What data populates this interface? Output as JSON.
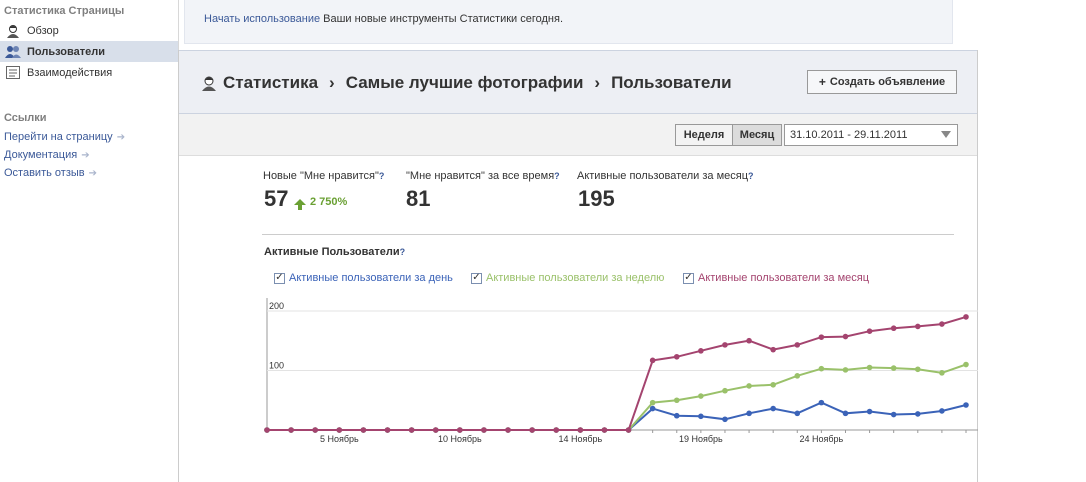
{
  "sidebar": {
    "section_stats": "Статистика Страницы",
    "items": [
      {
        "label": "Обзор",
        "icon": "user-avatar-icon",
        "active": false
      },
      {
        "label": "Пользователи",
        "icon": "users-icon",
        "active": true
      },
      {
        "label": "Взаимодействия",
        "icon": "interactions-icon",
        "active": false
      }
    ],
    "section_links": "Ссылки",
    "links": [
      "Перейти на страницу",
      "Документация",
      "Оставить отзыв"
    ]
  },
  "notice": {
    "link_text": "Начать использование",
    "text": " Ваши новые инструменты Статистики сегодня."
  },
  "breadcrumb": {
    "items": [
      "Статистика",
      "Самые лучшие фотографии",
      "Пользователи"
    ],
    "separator": "›"
  },
  "create_ad_label": "Создать объявление",
  "period": {
    "week_label": "Неделя",
    "month_label": "Месяц",
    "selected": "Месяц",
    "date_range": "31.10.2011 - 29.11.2011"
  },
  "metrics": [
    {
      "label": "Новые \"Мне нравится\"",
      "value": "57",
      "change": "2 750%"
    },
    {
      "label": "\"Мне нравится\" за все время",
      "value": "81"
    },
    {
      "label": "Активные пользователи за месяц",
      "value": "195"
    }
  ],
  "help_mark": "?",
  "chart_data": {
    "type": "line",
    "title": "Активные Пользователи",
    "ylim": [
      0,
      200
    ],
    "y_ticks": [
      100,
      200
    ],
    "x_tick_labels": [
      "5 Ноябрь",
      "10 Ноябрь",
      "14 Ноябрь",
      "19 Ноябрь",
      "24 Ноябрь"
    ],
    "x_tick_index": [
      3,
      8,
      13,
      18,
      23
    ],
    "legend": "top",
    "series": [
      {
        "name": "Активные пользователи за день",
        "color": "#3b63b8",
        "values": [
          0,
          0,
          0,
          0,
          0,
          0,
          0,
          0,
          0,
          0,
          0,
          0,
          0,
          0,
          0,
          0,
          36,
          24,
          23,
          18,
          28,
          36,
          28,
          46,
          28,
          31,
          26,
          27,
          32,
          42
        ]
      },
      {
        "name": "Активные пользователи за неделю",
        "color": "#9ac16a",
        "values": [
          0,
          0,
          0,
          0,
          0,
          0,
          0,
          0,
          0,
          0,
          0,
          0,
          0,
          0,
          0,
          0,
          46,
          50,
          57,
          66,
          74,
          76,
          91,
          103,
          101,
          105,
          104,
          102,
          96,
          110
        ]
      },
      {
        "name": "Активные пользователи за месяц",
        "color": "#a4446f",
        "values": [
          0,
          0,
          0,
          0,
          0,
          0,
          0,
          0,
          0,
          0,
          0,
          0,
          0,
          0,
          0,
          0,
          117,
          123,
          133,
          143,
          150,
          135,
          143,
          156,
          157,
          166,
          171,
          174,
          178,
          190
        ]
      }
    ]
  }
}
